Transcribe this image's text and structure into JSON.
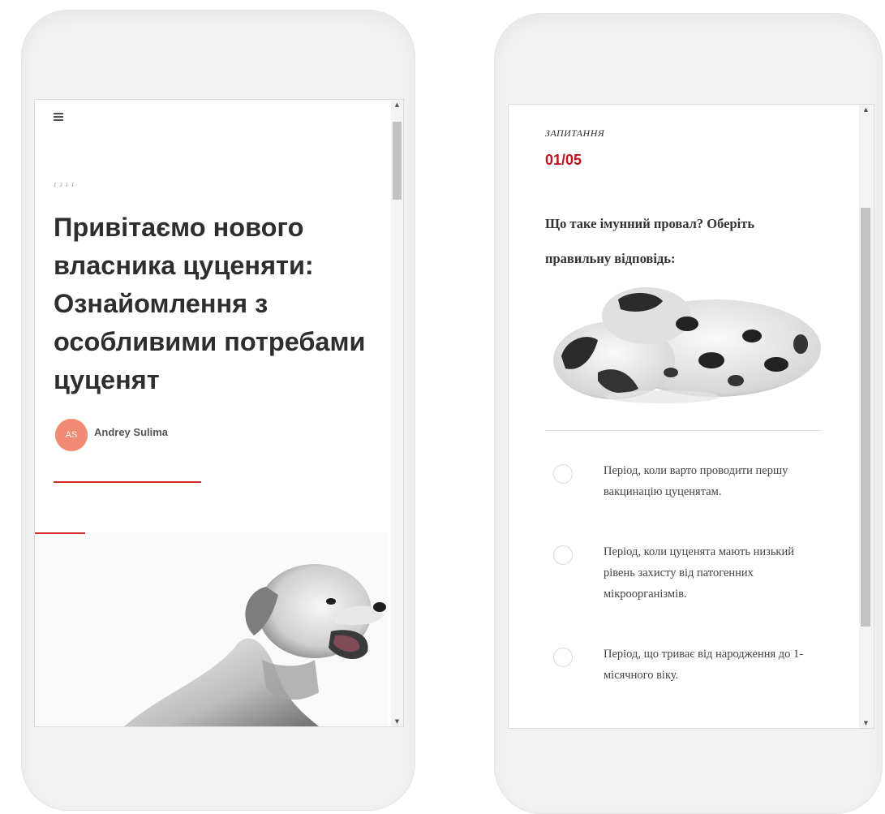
{
  "article": {
    "menu_icon": "hamburger-icon",
    "date": "1 3 1 1",
    "title": "Привітаємо нового власника цуценяти: Ознайомлення з особливими потребами цуценят",
    "author": {
      "initials": "AS",
      "name": "Andrey Sulima",
      "avatar_color": "#f08a73"
    },
    "accent_color": "#d42a2a",
    "hero_image": "puppy-barking-image"
  },
  "quiz": {
    "section_label": "ЗАПИТАННЯ",
    "counter": "01/05",
    "counter_color": "#c0141d",
    "question": "Що таке імунний провал? Оберіть правильну відповідь:",
    "image": "sleeping-puppies-image",
    "options": [
      {
        "label": "Період, коли варто проводити першу вакцинацію цуценятам."
      },
      {
        "label": "Період, коли цуценята мають низький рівень захисту від патогенних мікроорганізмів."
      },
      {
        "label": "Період, що триває від народження до 1-місячного віку."
      }
    ]
  }
}
